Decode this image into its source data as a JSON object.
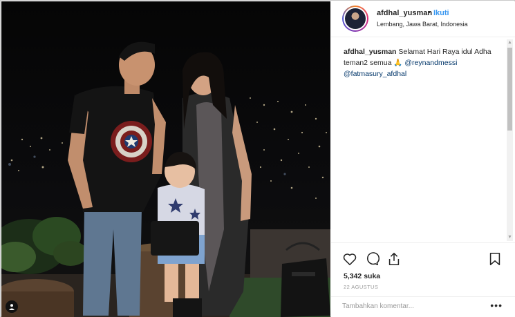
{
  "post": {
    "username": "afdhal_yusman",
    "separator": "•",
    "follow_label": "Ikuti",
    "location": "Lembang, Jawa Barat, Indonesia"
  },
  "caption": {
    "username": "afdhal_yusman",
    "text": " Selamat Hari Raya idul Adha teman2 semua 🙏 ",
    "mention_1": "@reynandmessi",
    "mention_2": "@fatmasury_afdhal"
  },
  "stats": {
    "likes": "5,342 suka",
    "date": "22 AGUSTUS"
  },
  "comment": {
    "placeholder": "Tambahkan komentar..."
  },
  "icons": {
    "like": "heart-icon",
    "comment": "comment-icon",
    "share": "share-icon",
    "save": "bookmark-icon",
    "more": "more-options-icon",
    "tag": "user-tag-icon"
  },
  "colors": {
    "link": "#3897f0",
    "mention": "#003569",
    "text": "#262626",
    "muted": "#999999"
  }
}
